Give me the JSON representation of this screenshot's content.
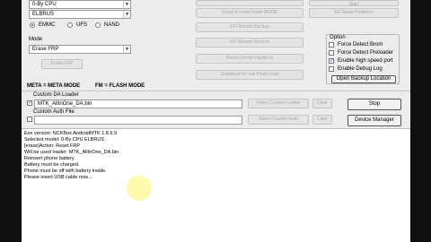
{
  "device": {
    "model_value": "0-By CPU",
    "chip_value": "ELBRUS"
  },
  "storage": {
    "options": [
      "EMMC",
      "UFS",
      "NAND"
    ],
    "selected": "EMMC"
  },
  "mode": {
    "heading": "Mode",
    "value": "Erase FRP",
    "action_label": "Erase FRP"
  },
  "top_buttons": [
    "Reset to Initial Flash MODE",
    "EFI Mounts Backup",
    "EFI Mounts Restore",
    "Reset Format Partitions",
    "Download for mtk Flash Load"
  ],
  "right_buttons": [
    "Start",
    "EFI Read Partitions"
  ],
  "options": {
    "heading": "Option",
    "items": [
      {
        "label": "Force Detect Brom",
        "checked": false
      },
      {
        "label": "Force Detect Preloader",
        "checked": false
      },
      {
        "label": "Enable high speed port",
        "checked": true
      },
      {
        "label": "Enable Debug Log",
        "checked": false
      }
    ],
    "backup_button": "Open Backup Location"
  },
  "status_bar": {
    "meta": "META = META MODE",
    "fm": "FM = FLASH MODE"
  },
  "da": {
    "heading": "Custom DA Loader",
    "value": "MTK_AllInOne_DA.bin",
    "checked": true,
    "select_button": "Select Custom Loader",
    "clear_button": "Clear"
  },
  "auth": {
    "heading": "Custom Auth File",
    "value": "",
    "checked": false,
    "select_button": "Select Custom Auth",
    "clear_button": "Clear"
  },
  "actions": {
    "stop": "Stop",
    "device_manager": "Device Manager"
  },
  "log": [
    "Exe version: NCKBox AndroidMTK 1.8.9.9",
    "Selected model: 0-By CPU  ELBRUS",
    "[erase]Action: Reset FRP",
    "Will be used loader: MTK_AllInOne_DA.bin",
    "Reinsert phone battery.",
    "Battery must be charged.",
    "Phone must be off with battery inside.",
    "Please insert USB cable now..."
  ],
  "colors": {
    "frame": "#101010",
    "panel": "#ececec",
    "highlight": "#fff8a0"
  }
}
